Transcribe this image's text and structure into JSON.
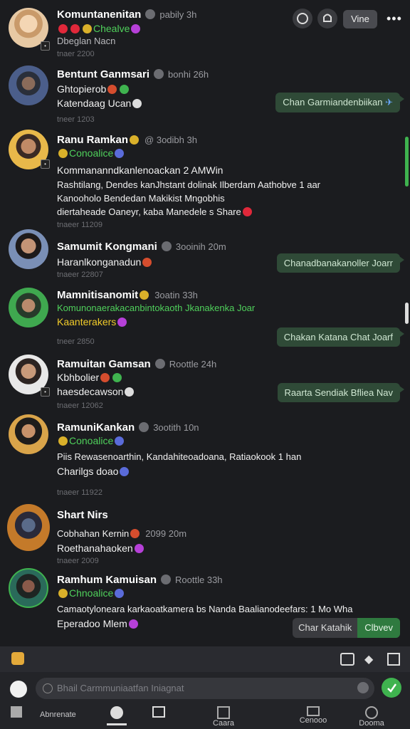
{
  "toolbar": {
    "primary_label": "Vine"
  },
  "messages": [
    {
      "name": "Komuntanenitan",
      "meta": "pabily 3h",
      "lines": [
        "Chealve"
      ],
      "ts": "tnaer 2200",
      "extra": "Dbeglan Nacn"
    },
    {
      "name": "Bentunt Ganmsari",
      "meta": "bonhi 26h",
      "lines": [
        "Ghtopierob",
        "Katendaag Ucan"
      ],
      "ts": "tneer 1203",
      "bubble": "Chan Garmiandenbiikan"
    },
    {
      "name": "Ranu Ramkan",
      "meta": "@ 3odibh 3h",
      "lines": [
        "Conoalice",
        "Kommananndkanlenoackan 2 AMWin",
        "Rashtilang, Dendes kanJhstant  dolinak Ilberdam Aathobve  1 aar",
        "Kanooholo Bendedan Makikist  Mngobhis",
        "diertaheade Oaneyr, kaba Manedele s Share"
      ],
      "ts": "tnaeer 11209"
    },
    {
      "name": "Samumit Kongmani",
      "meta": "3ooinih 20m",
      "lines": [
        "Haranlkonganadun"
      ],
      "ts": "tnaeer 22807",
      "bubble": "Chanadbanakanoller Joarr"
    },
    {
      "name": "Mamnitisanomit",
      "meta": "3oatin 33h",
      "lines": [
        "Komunonaerakacanbintokaoth Jkanakenka Joar",
        "Kaanterakers"
      ],
      "ts": "tneer 2850",
      "bubble": "Chakan Katana Chat Joarf"
    },
    {
      "name": "Ramuitan Gamsan",
      "meta": "Roottle 24h",
      "lines": [
        "Kbhbolier",
        "haesdecawson"
      ],
      "ts": "tnaeer 12062",
      "bubble": "Raarta Sendiak Bfliea  Nav"
    },
    {
      "name": "RamuniKankan",
      "meta": "3ootith 10n",
      "lines": [
        "Conoalice",
        "Piis  Rewasenoarthin, Kandahiteoadoana, Ratiaokook 1 han",
        "Charilgs  doao"
      ],
      "ts": "tnaeer 11922"
    },
    {
      "name": "Shart Nirs",
      "meta": "",
      "lines": [
        "Cobhahan Kernin",
        "Roethanahaoken"
      ],
      "ts": "tnaeer 2009",
      "extra": "2099 20m"
    },
    {
      "name": "Ramhum Kamuisan",
      "meta": "Roottle 33h",
      "lines": [
        "Chnoalice",
        "Camaotyloneara karkaoatkamera  bs  Nanda  Baalianodeefars:  1 Mo Wha",
        "Eperadoo  Mlem"
      ],
      "ts": "",
      "bubble": "Char Katahik",
      "bubble_action": "Clbvev"
    }
  ],
  "input": {
    "placeholder": "Bhail Carmmuniaatfan Iniagnat"
  },
  "nav": [
    "Abnrenate",
    "",
    "",
    "Caara",
    "",
    "Cenooo",
    "Dooma"
  ],
  "colors": {
    "accent": "#4fd05b",
    "bubble": "#2f4a37"
  }
}
